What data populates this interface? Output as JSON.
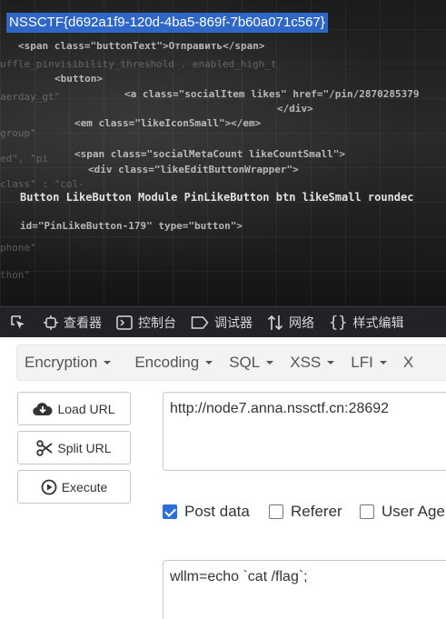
{
  "webpage": {
    "selected_text": "NSSCTF{d692a1f9-120d-4ba5-869f-7b60a071c567}",
    "code_fragments": [
      "<span class=\"buttonText\">Отправить</span>",
      "<button>",
      "<a class=\"socialItem likes\" href=\"/pin/2870285379",
      "</div>",
      "<em class=\"likeIconSmall\"></em>",
      "<span class=\"socialMetaCount likeCountSmall\">",
      "<div class=\"likeEditButtonWrapper\">",
      "Button LikeButton Module PinLikeButton btn likeSmall roundec",
      "id=\"PinLikeButton-179\" type=\"button\">"
    ]
  },
  "devtools": {
    "tabs": [
      {
        "label": "查看器",
        "icon": "inspector-icon"
      },
      {
        "label": "控制台",
        "icon": "console-icon"
      },
      {
        "label": "调试器",
        "icon": "debugger-icon"
      },
      {
        "label": "网络",
        "icon": "network-icon"
      },
      {
        "label": "样式编辑",
        "icon": "style-editor-icon"
      }
    ]
  },
  "hackbar": {
    "menu": [
      "Encryption",
      "Encoding",
      "SQL",
      "XSS",
      "LFI",
      "X"
    ],
    "buttons": {
      "load_url": "Load URL",
      "split_url": "Split URL",
      "execute": "Execute"
    },
    "url": "http://node7.anna.nssctf.cn:28692",
    "checkboxes": [
      {
        "label": "Post data",
        "checked": true
      },
      {
        "label": "Referer",
        "checked": false
      },
      {
        "label": "User Age",
        "checked": false
      }
    ],
    "post_data": "wllm=echo `cat /flag`;"
  }
}
